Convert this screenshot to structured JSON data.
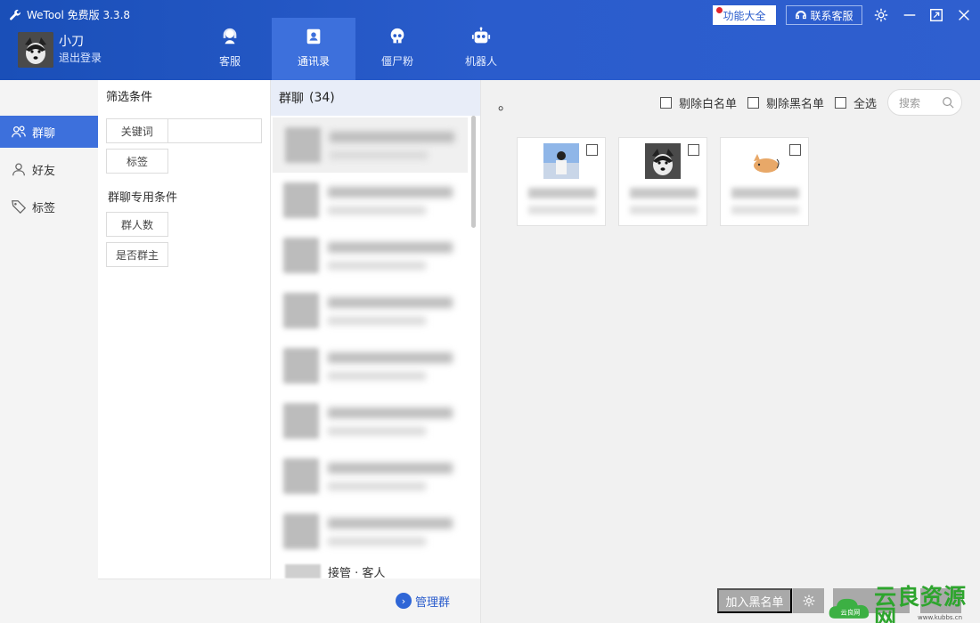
{
  "app": {
    "title": "WeTool 免费版 3.3.8"
  },
  "user": {
    "name": "小刀",
    "logout": "退出登录"
  },
  "nav": [
    {
      "label": "客服",
      "icon": "headset-icon"
    },
    {
      "label": "通讯录",
      "icon": "contacts-icon"
    },
    {
      "label": "僵尸粉",
      "icon": "skull-icon"
    },
    {
      "label": "机器人",
      "icon": "robot-icon"
    }
  ],
  "header_buttons": {
    "features": "功能大全",
    "contact": "联系客服"
  },
  "sidebar": [
    {
      "label": "群聊",
      "icon": "group-chat-icon"
    },
    {
      "label": "好友",
      "icon": "friend-icon"
    },
    {
      "label": "标签",
      "icon": "tag-icon"
    }
  ],
  "filters": {
    "title": "筛选条件",
    "keyword": "关键词",
    "tag": "标签",
    "group_title": "群聊专用条件",
    "member_count": "群人数",
    "is_owner": "是否群主"
  },
  "group_list": {
    "title": "群聊",
    "count": "(34)",
    "partial_item": "接管 · 客人",
    "manage": "管理群"
  },
  "right": {
    "mark": "。",
    "exclude_whitelist": "剔除白名单",
    "exclude_blacklist": "剔除黑名单",
    "select_all": "全选",
    "search_placeholder": "搜索",
    "add_blacklist": "加入黑名单"
  },
  "watermark": {
    "text": "云良资源网",
    "url": "www.kubbs.cn",
    "logo_text": "云良网"
  },
  "colors": {
    "accent": "#2a5ccc",
    "active_nav": "#3d70dc",
    "badge_red": "#e0242c",
    "watermark_green": "#2da52d"
  }
}
